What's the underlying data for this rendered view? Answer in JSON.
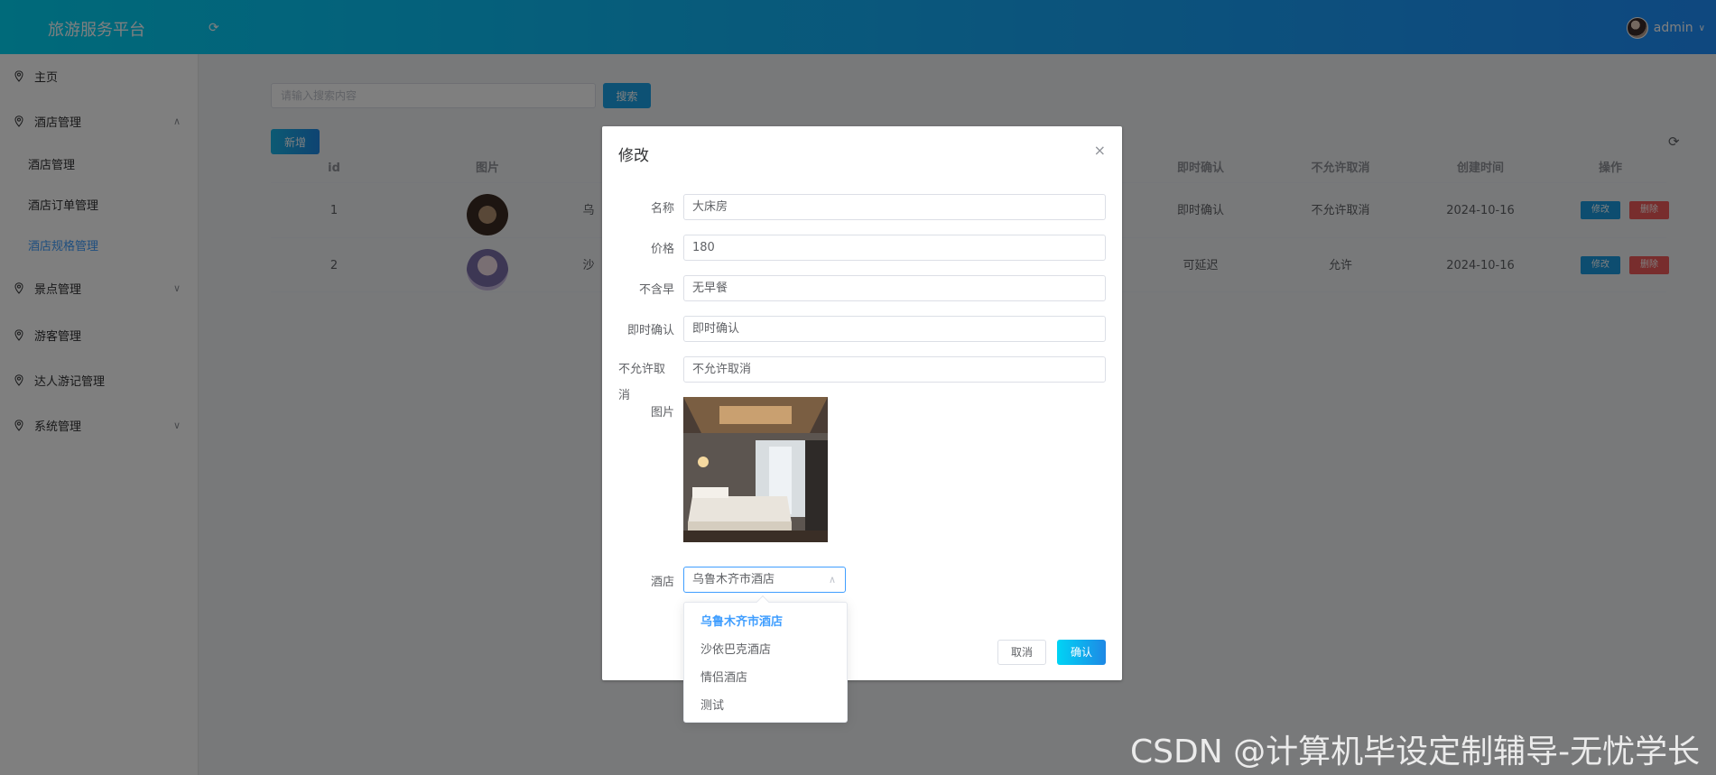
{
  "header": {
    "title": "旅游服务平台",
    "username": "admin"
  },
  "sidebar": {
    "items": [
      {
        "label": "主页"
      },
      {
        "label": "酒店管理",
        "children": [
          "酒店管理",
          "酒店订单管理",
          "酒店规格管理"
        ]
      },
      {
        "label": "景点管理"
      },
      {
        "label": "游客管理"
      },
      {
        "label": "达人游记管理"
      },
      {
        "label": "系统管理"
      }
    ]
  },
  "toolbar": {
    "search_placeholder": "请输入搜索内容",
    "search_label": "搜索",
    "add_label": "新增"
  },
  "table": {
    "columns": [
      "id",
      "图片",
      "",
      "即时确认",
      "不允许取消",
      "创建时间",
      "操作"
    ],
    "rows": [
      {
        "id": "1",
        "name_partial": "乌",
        "confirm": "即时确认",
        "cancel": "不允许取消",
        "created": "2024-10-16"
      },
      {
        "id": "2",
        "name_partial": "沙",
        "confirm": "可延迟",
        "cancel": "允许",
        "created": "2024-10-16"
      }
    ],
    "edit_label": "修改",
    "delete_label": "删除"
  },
  "dialog": {
    "title": "修改",
    "fields": {
      "name": {
        "label": "名称",
        "value": "大床房"
      },
      "price": {
        "label": "价格",
        "value": "180"
      },
      "breakfast": {
        "label": "不含早",
        "value": "无早餐"
      },
      "confirm": {
        "label": "即时确认",
        "value": "即时确认"
      },
      "cancel": {
        "label": "不允许取消",
        "value": "不允许取消"
      },
      "image": {
        "label": "图片"
      },
      "hotel": {
        "label": "酒店",
        "value": "乌鲁木齐市酒店"
      }
    },
    "cancel_label": "取消",
    "ok_label": "确认"
  },
  "dropdown": {
    "options": [
      "乌鲁木齐市酒店",
      "沙依巴克酒店",
      "情侣酒店",
      "测试"
    ],
    "selected_index": 0
  },
  "watermark": "CSDN @计算机毕设定制辅导-无忧学长"
}
